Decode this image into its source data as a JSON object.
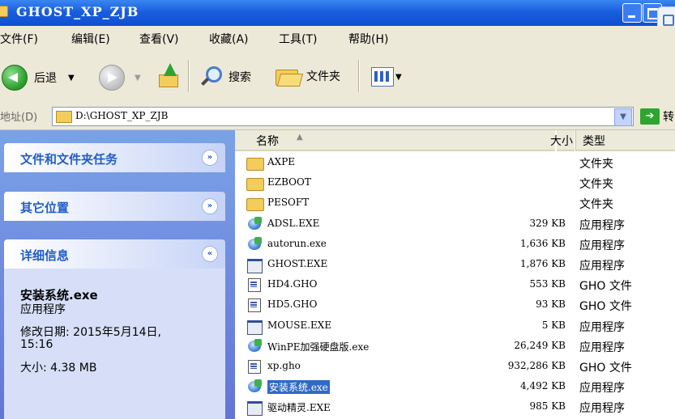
{
  "window": {
    "title": "GHOST_XP_ZJB"
  },
  "menu": [
    "文件(F)",
    "编辑(E)",
    "查看(V)",
    "收藏(A)",
    "工具(T)",
    "帮助(H)"
  ],
  "toolbar": {
    "back_label": "后退",
    "search_label": "搜索",
    "folders_label": "文件夹"
  },
  "address": {
    "label": "地址(D)",
    "path": "D:\\GHOST_XP_ZJB",
    "go_label": "转"
  },
  "sidebar": {
    "tasks_title": "文件和文件夹任务",
    "places_title": "其它位置",
    "details_title": "详细信息",
    "details": {
      "name": "安装系统.exe",
      "type": "应用程序",
      "modified_label": "修改日期: 2015年5月14日,",
      "modified_time": "15:16",
      "size": "大小: 4.38 MB"
    }
  },
  "columns": {
    "name": "名称",
    "size": "大小",
    "type": "类型"
  },
  "files": [
    {
      "name": "AXPE",
      "size": "",
      "type": "文件夹",
      "icon": "folder-icon"
    },
    {
      "name": "EZBOOT",
      "size": "",
      "type": "文件夹",
      "icon": "folder-icon"
    },
    {
      "name": "PESOFT",
      "size": "",
      "type": "文件夹",
      "icon": "folder-icon"
    },
    {
      "name": "ADSL.EXE",
      "size": "329 KB",
      "type": "应用程序",
      "icon": "app-icon"
    },
    {
      "name": "autorun.exe",
      "size": "1,636 KB",
      "type": "应用程序",
      "icon": "app-icon"
    },
    {
      "name": "GHOST.EXE",
      "size": "1,876 KB",
      "type": "应用程序",
      "icon": "exe-window-icon"
    },
    {
      "name": "HD4.GHO",
      "size": "553 KB",
      "type": "GHO 文件",
      "icon": "gho-file-icon"
    },
    {
      "name": "HD5.GHO",
      "size": "93 KB",
      "type": "GHO 文件",
      "icon": "gho-file-icon"
    },
    {
      "name": "MOUSE.EXE",
      "size": "5 KB",
      "type": "应用程序",
      "icon": "exe-window-icon"
    },
    {
      "name": "WinPE加强硬盘版.exe",
      "size": "26,249 KB",
      "type": "应用程序",
      "icon": "app-icon"
    },
    {
      "name": "xp.gho",
      "size": "932,286 KB",
      "type": "GHO 文件",
      "icon": "gho-file-icon"
    },
    {
      "name": "安装系统.exe",
      "size": "4,492 KB",
      "type": "应用程序",
      "icon": "app-icon",
      "selected": true
    },
    {
      "name": "驱动精灵.EXE",
      "size": "985 KB",
      "type": "应用程序",
      "icon": "exe-window-icon"
    }
  ]
}
